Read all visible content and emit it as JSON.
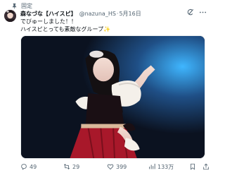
{
  "pinned": {
    "label": "固定",
    "icon": "pin-icon"
  },
  "author": {
    "name": "森なづな【ハイスピ】",
    "handle": "@nazuna_HS",
    "separator": "·",
    "date": "5月16日"
  },
  "tweet": {
    "line1": "でびゅーしました！！",
    "line2": "ハイスピとっても素敵なグループ",
    "sparkle": "✨"
  },
  "colors": {
    "secondary_text": "#536471",
    "sparkle": "#f4c430"
  },
  "metrics": {
    "replies": "49",
    "retweets": "29",
    "likes": "399",
    "views": "133万"
  },
  "icons": [
    "verified-icon",
    "grok-icon",
    "more-icon",
    "reply-icon",
    "retweet-icon",
    "like-icon",
    "views-icon",
    "bookmark-icon",
    "share-icon"
  ]
}
